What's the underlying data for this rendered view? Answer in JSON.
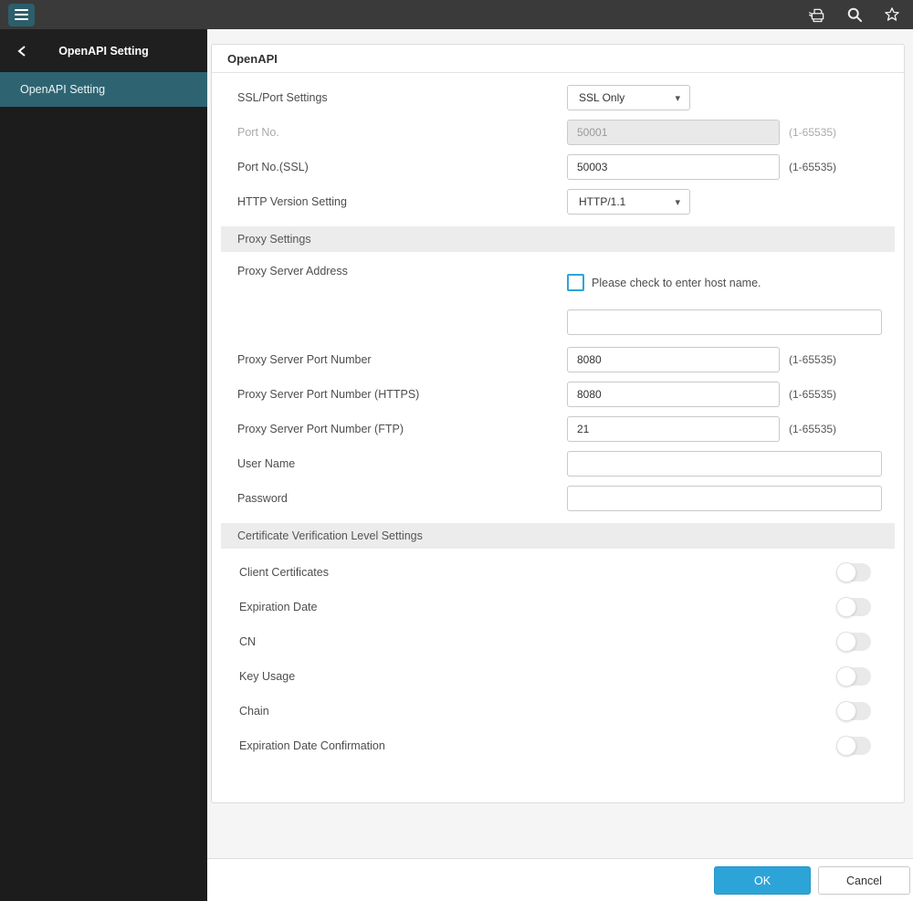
{
  "topbar": {
    "icons": {
      "menu": "hamburger-menu",
      "device": "printer",
      "search": "magnifier",
      "favorite": "star-outline"
    }
  },
  "sidebar": {
    "title": "OpenAPI Setting",
    "back_icon": "chevron-left",
    "items": [
      {
        "label": "OpenAPI Setting",
        "selected": true
      }
    ]
  },
  "panel": {
    "title": "OpenAPI",
    "openapi": {
      "ssl_port": {
        "label": "SSL/Port Settings",
        "value": "SSL Only"
      },
      "port": {
        "label": "Port No.",
        "value": "50001",
        "hint": "(1-65535)",
        "disabled": true
      },
      "port_ssl": {
        "label": "Port No.(SSL)",
        "value": "50003",
        "hint": "(1-65535)"
      },
      "http_version": {
        "label": "HTTP Version Setting",
        "value": "HTTP/1.1"
      }
    },
    "proxy": {
      "title": "Proxy Settings",
      "address": {
        "label": "Proxy Server Address",
        "checkbox_label": "Please check to enter host name.",
        "checked": false,
        "value": ""
      },
      "port": {
        "label": "Proxy Server Port Number",
        "value": "8080",
        "hint": "(1-65535)"
      },
      "port_https": {
        "label": "Proxy Server Port Number (HTTPS)",
        "value": "8080",
        "hint": "(1-65535)"
      },
      "port_ftp": {
        "label": "Proxy Server Port Number (FTP)",
        "value": "21",
        "hint": "(1-65535)"
      },
      "user_name": {
        "label": "User Name",
        "value": ""
      },
      "password": {
        "label": "Password",
        "value": ""
      }
    },
    "certificate": {
      "title": "Certificate Verification Level Settings",
      "toggles": [
        {
          "label": "Client Certificates",
          "on": false
        },
        {
          "label": "Expiration Date",
          "on": false
        },
        {
          "label": "CN",
          "on": false
        },
        {
          "label": "Key Usage",
          "on": false
        },
        {
          "label": "Chain",
          "on": false
        },
        {
          "label": "Expiration Date Confirmation",
          "on": false
        }
      ]
    }
  },
  "footer": {
    "ok": "OK",
    "cancel": "Cancel"
  },
  "colors": {
    "accent_blue": "#2da4d8",
    "accent_teal": "#2e6472",
    "topbar_bg": "#3a3a3a"
  }
}
